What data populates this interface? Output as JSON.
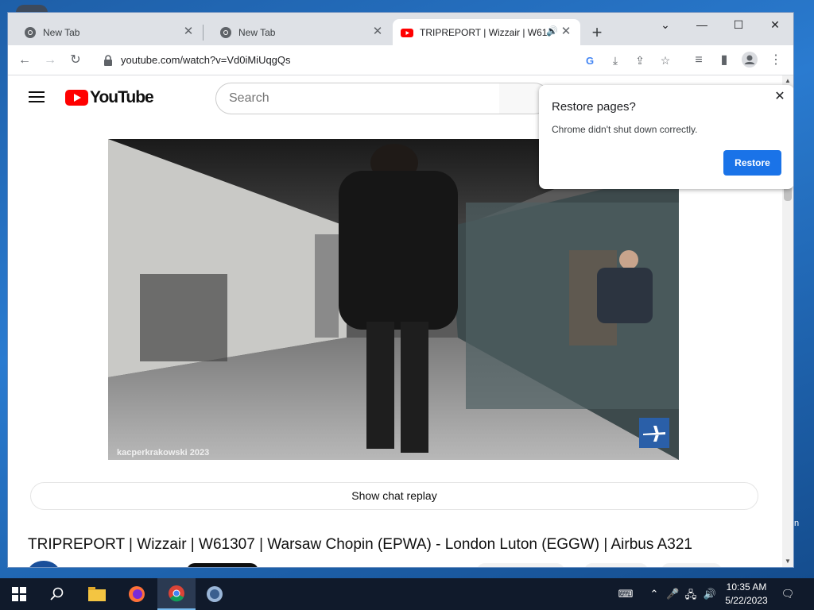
{
  "browser": {
    "tabs": [
      {
        "title": "New Tab"
      },
      {
        "title": "New Tab"
      },
      {
        "title": "TRIPREPORT | Wizzair | W61307 | Warsaw Chopin (EPWA) - London Luton (EGGW) | Airbus A321"
      }
    ],
    "url": "youtube.com/watch?v=Vd0iMiUqgQs"
  },
  "youtube": {
    "logo_text": "YouTube",
    "search_placeholder": "Search",
    "watermark": "kacperkrakowski 2023",
    "chat_replay_label": "Show chat replay",
    "video_title": "TRIPREPORT | Wizzair | W61307 | Warsaw Chopin (EPWA) - London Luton (EGGW) | Airbus A321"
  },
  "popup": {
    "title": "Restore pages?",
    "message": "Chrome didn't shut down correctly.",
    "button": "Restore"
  },
  "taskbar": {
    "time": "10:35 AM",
    "date": "5/22/2023"
  },
  "colors": {
    "youtube_red": "#ff0000",
    "chrome_blue": "#1a73e8",
    "taskbar": "#101a2b"
  }
}
